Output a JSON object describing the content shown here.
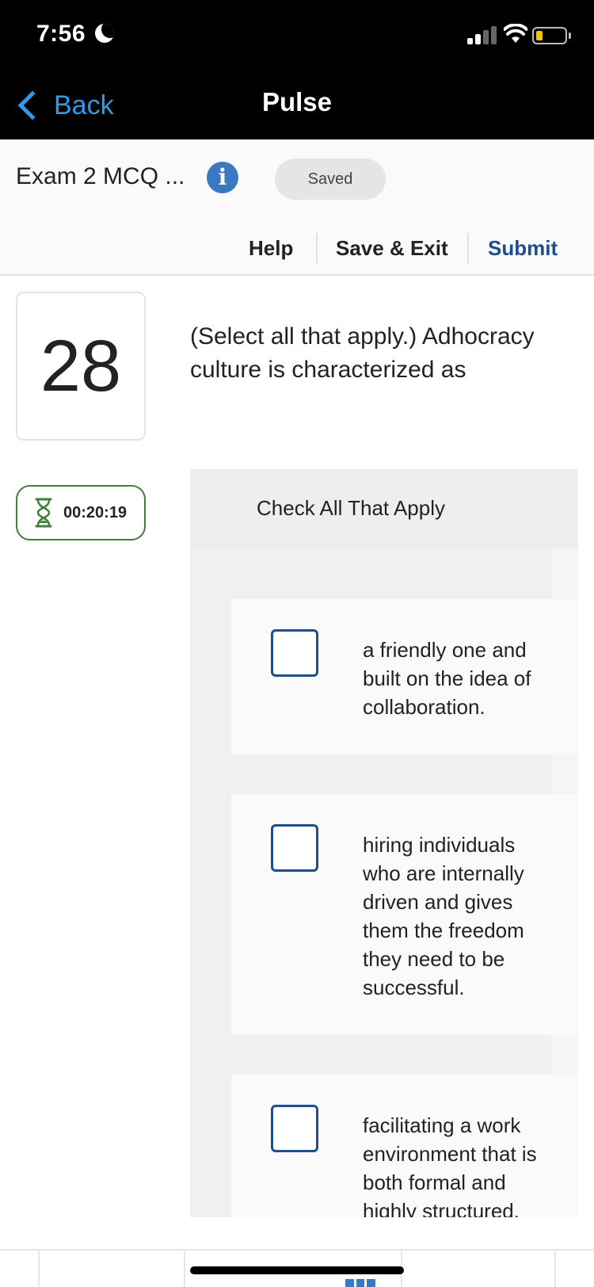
{
  "status_bar": {
    "time": "7:56",
    "battery_level": 0.2,
    "signal_bars_active": 2,
    "signal_bars_total": 4
  },
  "nav": {
    "back_label": "Back",
    "title": "Pulse"
  },
  "header": {
    "exam_title": "Exam 2 MCQ ...",
    "saved_label": "Saved",
    "toolbar": {
      "help": "Help",
      "save_exit": "Save & Exit",
      "submit": "Submit"
    }
  },
  "question": {
    "number": "28",
    "text": "(Select all that apply.) Adhocracy culture is characterized as"
  },
  "timer": {
    "value": "00:20:19"
  },
  "answer_panel": {
    "instruction": "Check All That Apply",
    "options": [
      {
        "text": "a friendly one and built on the idea of collaboration.",
        "checked": false
      },
      {
        "text": "hiring individuals who are internally driven and gives them the freedom they need to be successful.",
        "checked": false
      },
      {
        "text": "facilitating a work environment that is both formal and highly structured.",
        "checked": false
      }
    ]
  },
  "colors": {
    "link_blue": "#2e9bea",
    "submit_blue": "#1d4f8d",
    "checkbox_border": "#1d4f8d",
    "timer_green": "#3f7f3a",
    "info_blue": "#3a78c4"
  },
  "icons": {
    "back": "chevron-left-icon",
    "info": "info-circle-icon",
    "timer": "hourglass-icon",
    "status": [
      "moon-icon",
      "cellular-signal-icon",
      "wifi-icon",
      "battery-icon"
    ]
  }
}
